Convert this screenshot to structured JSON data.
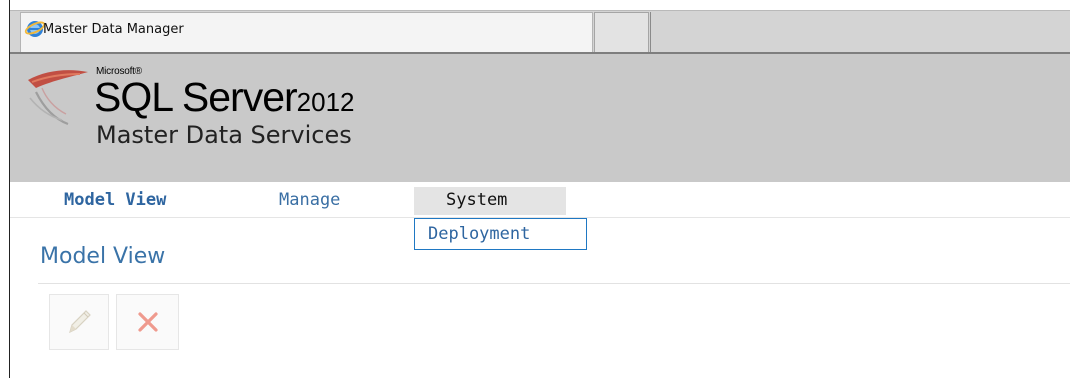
{
  "browser": {
    "tab_title": "Master Data Manager",
    "icons": {
      "tab_icon": "internet-explorer-icon"
    }
  },
  "header": {
    "brand_small": "Microsoft®",
    "product": "SQL Server",
    "version": "2012",
    "subtitle": "Master Data Services",
    "logo_icon": "sql-server-logo-icon",
    "background": "#c9c9c9"
  },
  "nav": {
    "items": [
      {
        "label": "Model View",
        "active": true
      },
      {
        "label": "Manage",
        "active": false
      },
      {
        "label": "System",
        "active": false,
        "open": true
      }
    ],
    "system_menu": {
      "items": [
        "Deployment"
      ]
    },
    "colors": {
      "link": "#3a6fa4",
      "menu_border": "#1f78c3"
    }
  },
  "main": {
    "title": "Model View",
    "toolbar": {
      "edit_icon": "pencil-icon",
      "delete_icon": "red-x-delete-icon",
      "buttons_disabled": true
    }
  }
}
